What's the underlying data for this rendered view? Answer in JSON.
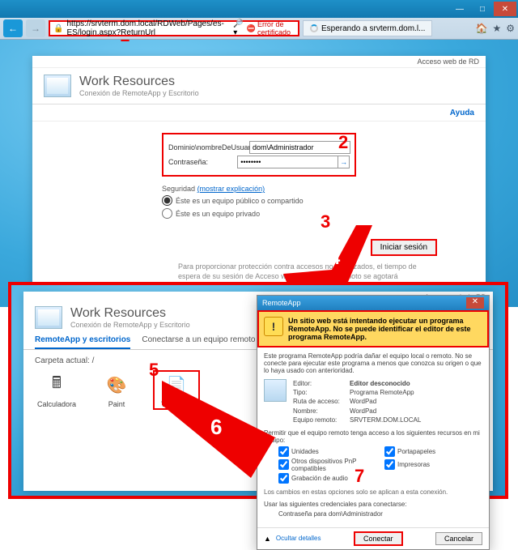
{
  "browser": {
    "url": "https://srvterm.dom.local/RDWeb/Pages/es-ES/login.aspx?ReturnUrl",
    "cert_error": "Error de certificado",
    "tab_label": "Esperando a srvterm.dom.l..."
  },
  "rd": {
    "top_link": "Acceso web de RD",
    "title": "Work Resources",
    "subtitle": "Conexión de RemoteApp y Escritorio",
    "help": "Ayuda",
    "user_label": "Dominio\\nombreDeUsuario:",
    "user_value": "dom\\Administrador",
    "pwd_label": "Contraseña:",
    "pwd_value": "••••••••",
    "security_label": "Seguridad",
    "security_link": "(mostrar explicación)",
    "radio_public": "Éste es un equipo público o compartido",
    "radio_private": "Éste es un equipo privado",
    "submit": "Iniciar sesión",
    "footer": "Para proporcionar protección contra accesos no autorizados, el tiempo de espera de su sesión de Acceso web de Escritorio remoto se agotará automáticamente tras un período de inactividad. Si finaliza la sesión, actualice el explorador y vuelva a iniciar sesión."
  },
  "rd2": {
    "tab1": "RemoteApp y escritorios",
    "tab2": "Conectarse a un equipo remoto",
    "folder": "Carpeta actual: /",
    "apps": [
      {
        "name": "Calculadora"
      },
      {
        "name": "Paint"
      },
      {
        "name": "WordPad"
      }
    ]
  },
  "dialog": {
    "title": "RemoteApp",
    "warning": "Un sitio web está intentando ejecutar un programa RemoteApp. No se puede identificar el editor de este programa RemoteApp.",
    "desc": "Este programa RemoteApp podría dañar el equipo local o remoto. No se conecte para ejecutar este programa a menos que conozca su origen o que lo haya usado con anterioridad.",
    "rows": {
      "editor_l": "Editor:",
      "editor_v": "Editor desconocido",
      "tipo_l": "Tipo:",
      "tipo_v": "Programa RemoteApp",
      "ruta_l": "Ruta de acceso:",
      "ruta_v": "WordPad",
      "nombre_l": "Nombre:",
      "nombre_v": "WordPad",
      "equipo_l": "Equipo remoto:",
      "equipo_v": "SRVTERM.DOM.LOCAL"
    },
    "perm_hdr": "Permitir que el equipo remoto tenga acceso a los siguientes recursos en mi equipo:",
    "check_unidades": "Unidades",
    "check_porta": "Portapapeles",
    "check_pnp": "Otros dispositivos PnP compatibles",
    "check_impr": "Impresoras",
    "check_audio": "Grabación de audio",
    "note": "Los cambios en estas opciones solo se aplican a esta conexión.",
    "cred_hdr": "Usar las siguientes credenciales para conectarse:",
    "cred_val": "Contraseña para dom\\Administrador",
    "hide": "Ocultar detalles",
    "connect": "Conectar",
    "cancel": "Cancelar"
  },
  "callouts": {
    "n1": "1",
    "n2": "2",
    "n3": "3",
    "n4": "4",
    "n5": "5",
    "n6": "6",
    "n7": "7"
  }
}
